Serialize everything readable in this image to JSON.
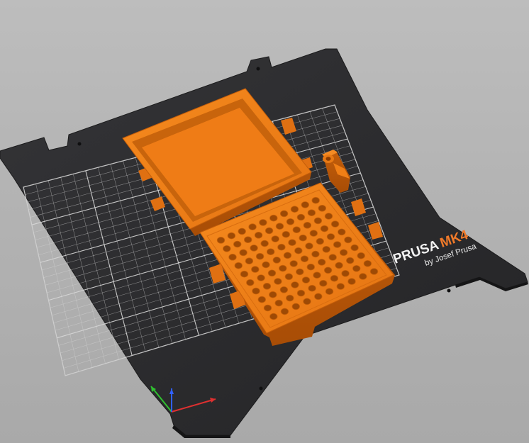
{
  "viewport": {
    "background_color": "#b6b6b6",
    "bed": {
      "brand": "PRUSA",
      "model": "MK4",
      "maker": "by Josef Prusa",
      "plate_color": "#2b2b2d",
      "grid_color": "#d8d8d8",
      "accent_color": "#f07a2a"
    },
    "objects": [
      {
        "name": "box-lid",
        "color": "#f07f16"
      },
      {
        "name": "box-base-with-holes",
        "color": "#f07f16"
      },
      {
        "name": "hinge-pin",
        "color": "#f07f16"
      }
    ],
    "base_holes": {
      "rows": 10,
      "cols": 10
    },
    "axes": {
      "x_color": "#e03030",
      "y_color": "#30c030",
      "z_color": "#3060ff"
    }
  }
}
